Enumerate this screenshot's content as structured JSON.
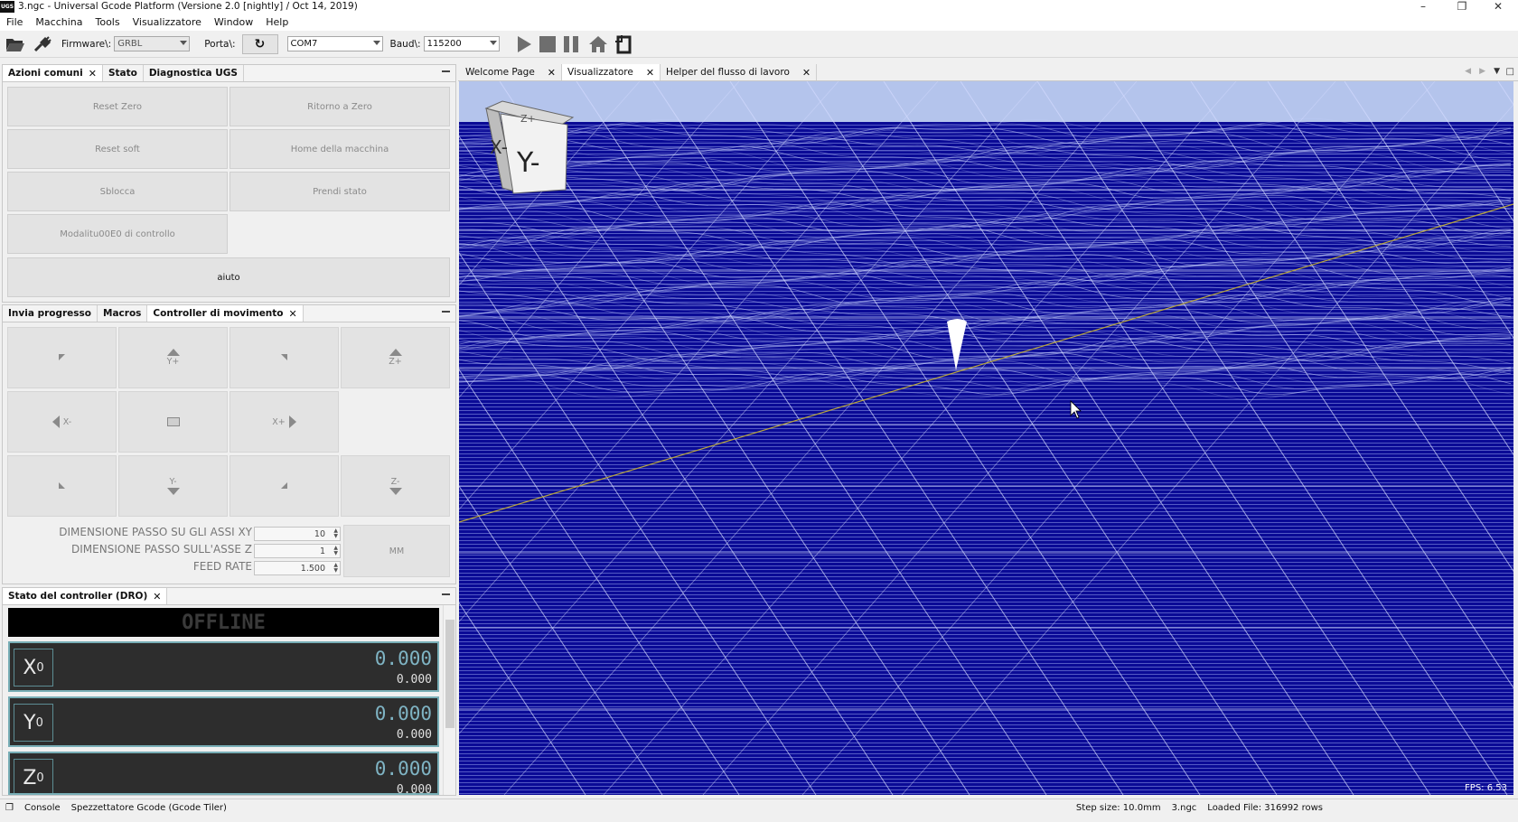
{
  "window": {
    "logo": "UGS",
    "title": "3.ngc - Universal Gcode Platform (Versione 2.0 [nightly]  / Oct 14, 2019)"
  },
  "menu": [
    "File",
    "Macchina",
    "Tools",
    "Visualizzatore",
    "Window",
    "Help"
  ],
  "toolbar": {
    "firmware_label": "Firmware\\:",
    "firmware_value": "GRBL",
    "port_label": "Porta\\:",
    "port_value": "COM7",
    "baud_label": "Baud\\:",
    "baud_value": "115200"
  },
  "actions_panel": {
    "tabs": [
      "Azioni comuni",
      "Stato",
      "Diagnostica UGS"
    ],
    "buttons": {
      "reset_zero": "Reset Zero",
      "return_zero": "Ritorno a Zero",
      "soft_reset": "Reset soft",
      "home": "Home della macchina",
      "unlock": "Sblocca",
      "get_state": "Prendi stato",
      "check_mode": "Modalitu00E0 di controllo",
      "help": "aiuto"
    }
  },
  "jog_panel": {
    "tabs": [
      "Invia progresso",
      "Macros",
      "Controller di movimento"
    ],
    "labels": {
      "y_plus": "Y+",
      "z_plus": "Z+",
      "x_minus": "X-",
      "x_plus": "X+",
      "y_minus": "Y-",
      "z_minus": "Z-",
      "unit": "MM"
    },
    "fields": {
      "xy_step_label": "DIMENSIONE PASSO SU GLI ASSI XY",
      "xy_step_value": "10",
      "z_step_label": "DIMENSIONE PASSO SULL'ASSE Z",
      "z_step_value": "1",
      "feed_label": "FEED RATE",
      "feed_value": "1.500"
    }
  },
  "dro": {
    "tab": "Stato del controller (DRO)",
    "state": "OFFLINE",
    "axes": [
      {
        "name": "X",
        "sub": "0",
        "work": "0.000",
        "machine": "0.000"
      },
      {
        "name": "Y",
        "sub": "0",
        "work": "0.000",
        "machine": "0.000"
      },
      {
        "name": "Z",
        "sub": "0",
        "work": "0.000",
        "machine": "0.000"
      }
    ]
  },
  "visualizer": {
    "tabs": [
      "Welcome Page",
      "Visualizzatore",
      "Helper del flusso di lavoro"
    ],
    "cube_face": "Y-",
    "cube_top": "Z+",
    "cube_side": "X-",
    "fps": "FPS: 6.53",
    "colors": {
      "background": "#0a0a96",
      "mesh": "#c8d2ff",
      "sky": "#b4c4ec"
    }
  },
  "statusbar": {
    "console": "Console",
    "tiler": "Spezzettatore Gcode (Gcode Tiler)",
    "step_size": "Step size: 10.0mm",
    "file": "3.ngc",
    "loaded": "Loaded File: 316992 rows"
  }
}
